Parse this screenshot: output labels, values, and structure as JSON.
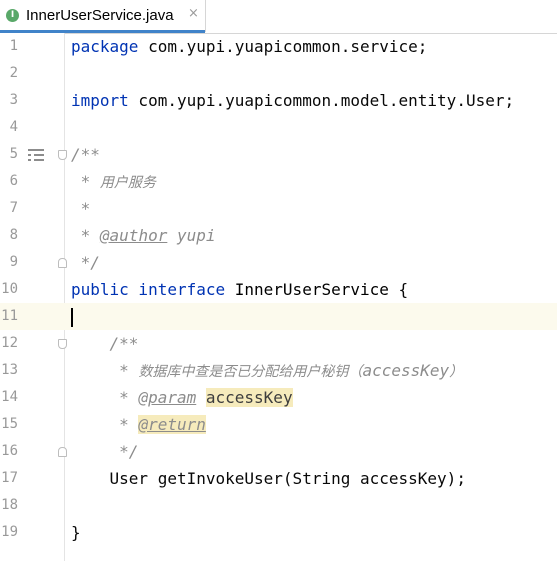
{
  "tab": {
    "icon_letter": "I",
    "filename": "InnerUserService.java",
    "close_glyph": "×"
  },
  "lines": [
    {
      "num": "1",
      "tokens": [
        {
          "t": "package",
          "c": "kw"
        },
        {
          "t": " com.yupi.yuapicommon.service;",
          "c": ""
        }
      ]
    },
    {
      "num": "2",
      "tokens": []
    },
    {
      "num": "3",
      "tokens": [
        {
          "t": "import",
          "c": "kw"
        },
        {
          "t": " com.yupi.yuapicommon.model.entity.User;",
          "c": ""
        }
      ]
    },
    {
      "num": "4",
      "tokens": []
    },
    {
      "num": "5",
      "tokens": [
        {
          "t": "/**",
          "c": "cmt"
        }
      ]
    },
    {
      "num": "6",
      "tokens": [
        {
          "t": " * ",
          "c": "cmt"
        },
        {
          "t": "用户服务",
          "c": "cmt cn"
        }
      ]
    },
    {
      "num": "7",
      "tokens": [
        {
          "t": " *",
          "c": "cmt"
        }
      ]
    },
    {
      "num": "8",
      "tokens": [
        {
          "t": " * ",
          "c": "cmt"
        },
        {
          "t": "@author",
          "c": "tag"
        },
        {
          "t": " yupi",
          "c": "cmt"
        }
      ]
    },
    {
      "num": "9",
      "tokens": [
        {
          "t": " */",
          "c": "cmt"
        }
      ]
    },
    {
      "num": "10",
      "tokens": [
        {
          "t": "public interface",
          "c": "kw"
        },
        {
          "t": " InnerUserService",
          "c": "iface"
        },
        {
          "t": " {",
          "c": ""
        }
      ]
    },
    {
      "num": "11",
      "tokens": []
    },
    {
      "num": "12",
      "tokens": [
        {
          "t": "    /**",
          "c": "cmt"
        }
      ]
    },
    {
      "num": "13",
      "tokens": [
        {
          "t": "     * ",
          "c": "cmt"
        },
        {
          "t": "数据库中查是否已分配给用户秘钥（",
          "c": "cmt cn"
        },
        {
          "t": "accessKey",
          "c": "cmt"
        },
        {
          "t": "）",
          "c": "cmt cn"
        }
      ]
    },
    {
      "num": "14",
      "tokens": [
        {
          "t": "     * ",
          "c": "cmt"
        },
        {
          "t": "@param",
          "c": "tag"
        },
        {
          "t": " ",
          "c": "cmt"
        },
        {
          "t": "accessKey",
          "c": "paramname"
        }
      ]
    },
    {
      "num": "15",
      "tokens": [
        {
          "t": "     * ",
          "c": "cmt"
        },
        {
          "t": "@return",
          "c": "tag retbg"
        }
      ]
    },
    {
      "num": "16",
      "tokens": [
        {
          "t": "     */",
          "c": "cmt"
        }
      ]
    },
    {
      "num": "17",
      "tokens": [
        {
          "t": "    User getInvokeUser(String accessKey);",
          "c": ""
        }
      ]
    },
    {
      "num": "18",
      "tokens": []
    },
    {
      "num": "19",
      "tokens": [
        {
          "t": "}",
          "c": ""
        }
      ]
    }
  ]
}
